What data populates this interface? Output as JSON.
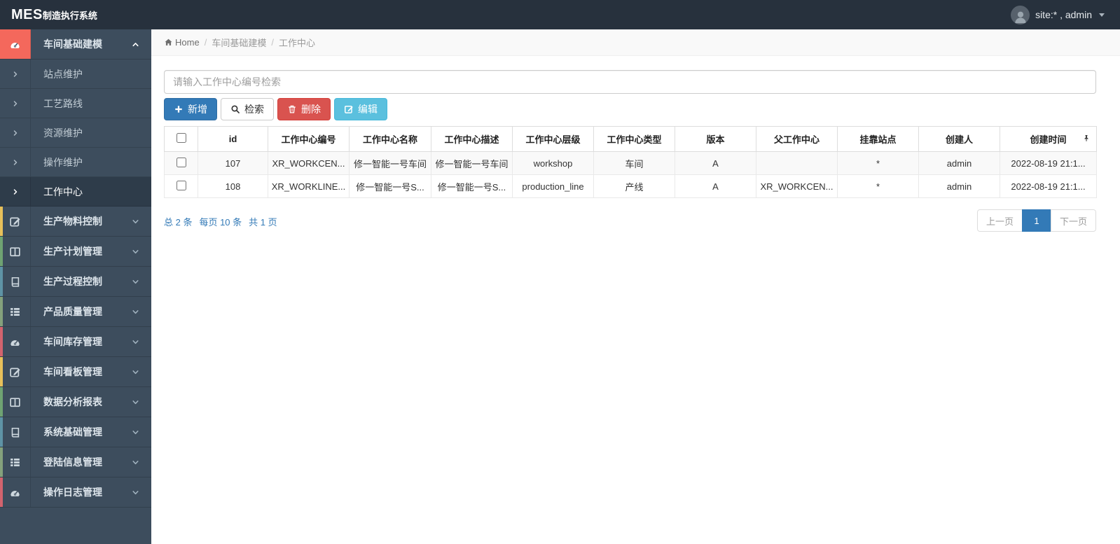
{
  "navbar": {
    "brand_bold": "MES",
    "brand_rest": "制造执行系统",
    "user_label": "site:* , admin"
  },
  "breadcrumb": {
    "home": "Home",
    "separator": "/",
    "items": [
      "车间基础建模",
      "工作中心"
    ]
  },
  "sidebar": {
    "expanded_item": {
      "label": "车间基础建模",
      "icon": "dashboard-icon"
    },
    "submenu": [
      {
        "label": "站点维护",
        "active": false
      },
      {
        "label": "工艺路线",
        "active": false
      },
      {
        "label": "资源维护",
        "active": false
      },
      {
        "label": "操作维护",
        "active": false
      },
      {
        "label": "工作中心",
        "active": true
      }
    ],
    "items": [
      {
        "label": "生产物料控制",
        "icon": "edit-icon",
        "strip": "#e7c05a"
      },
      {
        "label": "生产计划管理",
        "icon": "columns-icon",
        "strip": "#6fa372"
      },
      {
        "label": "生产过程控制",
        "icon": "book-icon",
        "strip": "#5e93a5"
      },
      {
        "label": "产品质量管理",
        "icon": "list-icon",
        "strip": "#84a17c"
      },
      {
        "label": "车间库存管理",
        "icon": "dashboard-icon",
        "strip": "#d2636e"
      },
      {
        "label": "车间看板管理",
        "icon": "edit-icon",
        "strip": "#e7c05a"
      },
      {
        "label": "数据分析报表",
        "icon": "columns-icon",
        "strip": "#6fa372"
      },
      {
        "label": "系统基础管理",
        "icon": "book-icon",
        "strip": "#5e93a5"
      },
      {
        "label": "登陆信息管理",
        "icon": "list-icon",
        "strip": "#84a17c"
      },
      {
        "label": "操作日志管理",
        "icon": "dashboard-icon",
        "strip": "#d2636e"
      }
    ]
  },
  "search": {
    "placeholder": "请输入工作中心编号检索",
    "value": ""
  },
  "toolbar": {
    "add_label": "新增",
    "search_label": "检索",
    "delete_label": "删除",
    "edit_label": "编辑"
  },
  "table": {
    "columns": [
      "id",
      "工作中心编号",
      "工作中心名称",
      "工作中心描述",
      "工作中心层级",
      "工作中心类型",
      "版本",
      "父工作中心",
      "挂靠站点",
      "创建人",
      "创建时间"
    ],
    "rows": [
      [
        "107",
        "XR_WORKCEN...",
        "修一智能一号车间",
        "修一智能一号车间",
        "workshop",
        "车间",
        "A",
        "",
        "*",
        "admin",
        "2022-08-19 21:1..."
      ],
      [
        "108",
        "XR_WORKLINE...",
        "修一智能一号S...",
        "修一智能一号S...",
        "production_line",
        "产线",
        "A",
        "XR_WORKCEN...",
        "*",
        "admin",
        "2022-08-19 21:1..."
      ]
    ]
  },
  "pagination": {
    "summary_total": "总 2 条",
    "summary_per_page": "每页 10 条",
    "summary_pages": "共 1 页",
    "prev_label": "上一页",
    "current_page": "1",
    "next_label": "下一页"
  },
  "colors": {
    "navbar_bg": "#27313d",
    "sidebar_bg": "#3d4d5d",
    "active_parent_icon_bg": "#f4685c",
    "primary_blue": "#337ab7",
    "danger_red": "#d9534f",
    "info_cyan": "#5bc0de"
  }
}
